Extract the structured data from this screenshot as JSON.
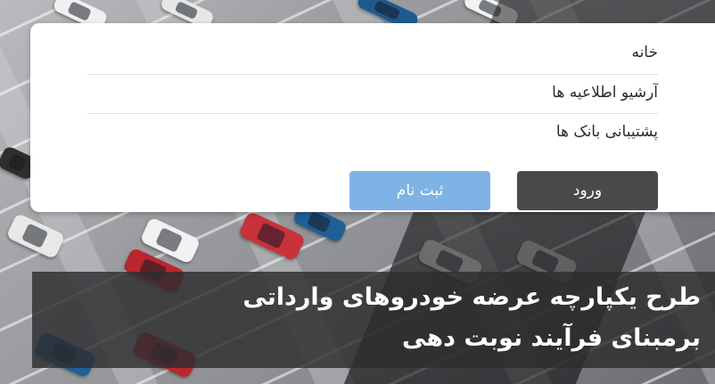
{
  "menu": {
    "items": [
      {
        "label": "خانه"
      },
      {
        "label": "آرشیو اطلاعیه ها"
      },
      {
        "label": "پشتیبانی بانک ها"
      }
    ]
  },
  "buttons": {
    "login_label": "ورود",
    "register_label": "ثبت نام"
  },
  "colors": {
    "login_button": "#4a4a4a",
    "register_button": "#7fb3e6",
    "headline_background": "#2d2d30"
  },
  "headline": {
    "line1": "طرح یکپارچه عرضه خودروهای وارداتی",
    "line2": "برمبنای فرآیند نوبت دهی"
  }
}
